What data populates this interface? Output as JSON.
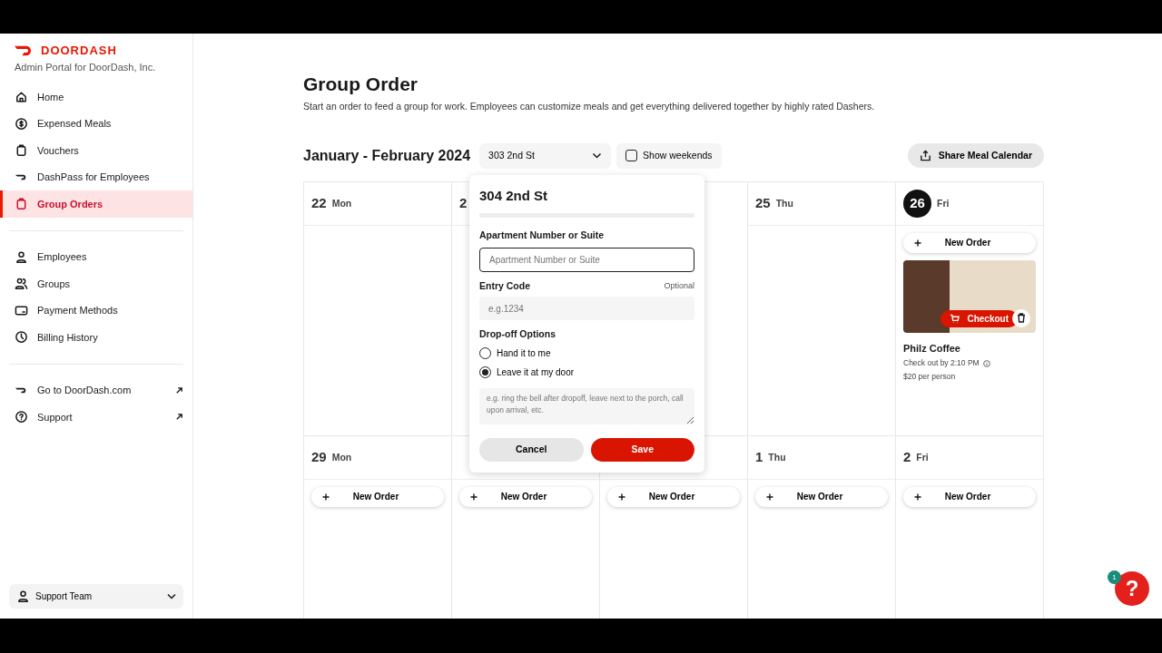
{
  "brand": {
    "logo_text": "DOORDASH",
    "subtitle": "Admin Portal for DoorDash, Inc."
  },
  "nav_groups": [
    {
      "items": [
        {
          "label": "Home",
          "selected": false,
          "external": false
        },
        {
          "label": "Expensed Meals",
          "selected": false,
          "external": false
        },
        {
          "label": "Vouchers",
          "selected": false,
          "external": false
        },
        {
          "label": "DashPass for Employees",
          "selected": false,
          "external": false
        },
        {
          "label": "Group Orders",
          "selected": true,
          "external": false
        }
      ]
    },
    {
      "items": [
        {
          "label": "Employees",
          "selected": false,
          "external": false
        },
        {
          "label": "Groups",
          "selected": false,
          "external": false
        },
        {
          "label": "Payment Methods",
          "selected": false,
          "external": false
        },
        {
          "label": "Billing History",
          "selected": false,
          "external": false
        }
      ]
    },
    {
      "items": [
        {
          "label": "Go to DoorDash.com",
          "selected": false,
          "external": true
        },
        {
          "label": "Support",
          "selected": false,
          "external": true
        }
      ]
    }
  ],
  "account": {
    "label": "Support Team"
  },
  "page": {
    "title": "Group Order",
    "description": "Start an order to feed a group for work. Employees can customize meals and get everything delivered together by highly rated Dashers."
  },
  "toolbar": {
    "range": "January - February 2024",
    "location": "303 2nd St",
    "show_weekends": {
      "label": "Show weekends",
      "checked": false
    },
    "share_button": "Share Meal Calendar"
  },
  "calendar": {
    "weeks": [
      {
        "days": [
          {
            "day": "22",
            "weekday": "Mon",
            "today": false
          },
          {
            "day": "2",
            "today": false
          },
          {
            "kind": "covered"
          },
          {
            "day": "25",
            "weekday": "Thu",
            "today": false
          },
          {
            "day": "26",
            "weekday": "Fri",
            "today": true,
            "new_order": "New Order",
            "orders": [
              {
                "checkout_button": "Checkout",
                "name": "Philz Coffee",
                "deadline": "Check out by 2:10 PM",
                "price": "$20 per person"
              }
            ]
          }
        ]
      },
      {
        "days": [
          {
            "day": "29",
            "weekday": "Mon",
            "today": false,
            "new_order": "New Order"
          },
          {
            "new_order": "New Order"
          },
          {
            "new_order": "New Order"
          },
          {
            "day": "1",
            "weekday": "Thu",
            "today": false,
            "new_order": "New Order"
          },
          {
            "day": "2",
            "weekday": "Fri",
            "today": false,
            "new_order": "New Order"
          }
        ]
      }
    ]
  },
  "popover": {
    "title": "304 2nd St",
    "apartment": {
      "label": "Apartment Number or Suite",
      "placeholder": "Apartment Number or Suite"
    },
    "entry_code": {
      "label": "Entry Code",
      "hint": "Optional",
      "placeholder": "e.g.1234"
    },
    "dropoff": {
      "label": "Drop-off Options",
      "options": [
        {
          "label": "Hand it to me",
          "selected": false
        },
        {
          "label": "Leave it at my door",
          "selected": true
        }
      ],
      "placeholder": "e.g. ring the bell after dropoff, leave next to the porch, call upon arrival, etc."
    },
    "cancel": "Cancel",
    "save": "Save"
  },
  "help": {
    "glyph": "?",
    "badge": "1"
  }
}
